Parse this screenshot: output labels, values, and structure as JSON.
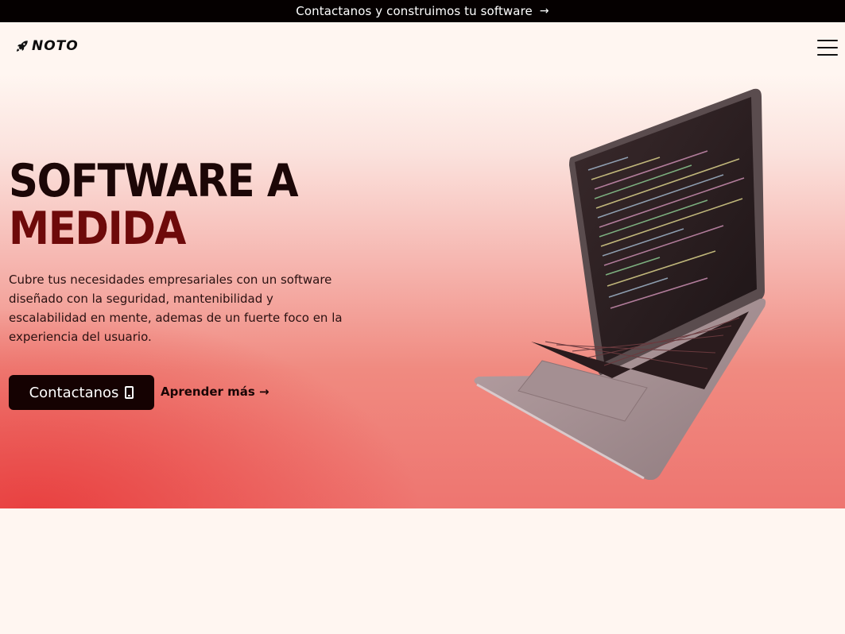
{
  "announcement": {
    "text": "Contactanos y construimos tu software",
    "arrow": "→"
  },
  "nav": {
    "brand": "NOTO",
    "logo_icon": "rocket-icon",
    "menu_icon": "hamburger-menu-icon"
  },
  "hero": {
    "title_line1": "SOFTWARE A",
    "title_line2": "MEDIDA",
    "description": "Cubre tus necesidades empresariales con un software diseñado con la seguridad, mantenibilidad y escalabilidad en mente, ademas de un fuerte foco en la experiencia del usuario.",
    "primary_button": "Contactanos",
    "primary_button_icon": "smartphone-icon",
    "secondary_link": "Aprender más →",
    "image": "laptop-with-code-image"
  },
  "colors": {
    "topbar": "#050000",
    "background": "#fff6f1",
    "title_dark": "#1c0707",
    "title_red": "#6e0a0a",
    "button": "#150202",
    "gradient_red": "#e83c3c"
  }
}
